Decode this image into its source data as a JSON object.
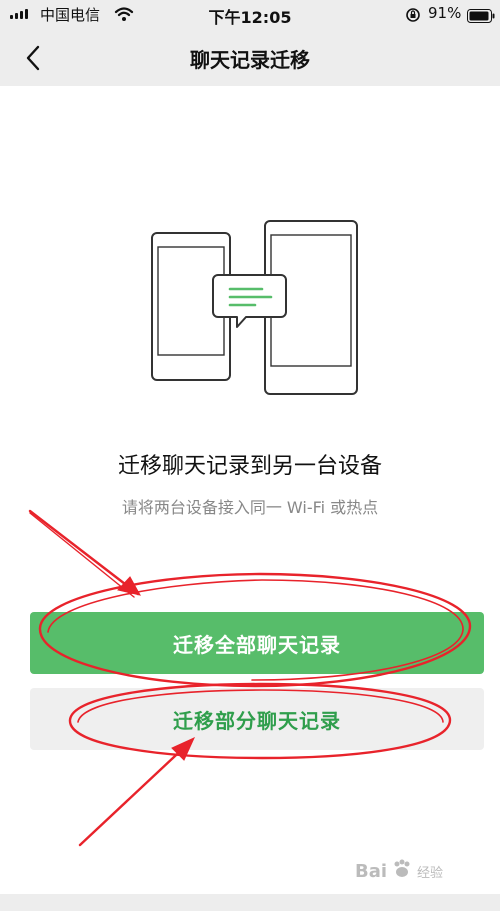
{
  "status_bar": {
    "carrier": "中国电信",
    "time": "下午12:05",
    "battery": "91%"
  },
  "nav": {
    "title": "聊天记录迁移",
    "back_icon": "chevron-left-icon"
  },
  "main": {
    "illustration_icon": "two-phones-chat-transfer-icon",
    "heading": "迁移聊天记录到另一台设备",
    "subtext": "请将两台设备接入同一 Wi-Fi 或热点",
    "primary_button": "迁移全部聊天记录",
    "secondary_button": "迁移部分聊天记录"
  },
  "watermark": {
    "text": "Bai",
    "suffix": "经验"
  },
  "colors": {
    "brand_green": "#57bd6a",
    "secondary_text_green": "#2f9e4c",
    "annotation_red": "#e8232b",
    "background": "#ededed"
  }
}
